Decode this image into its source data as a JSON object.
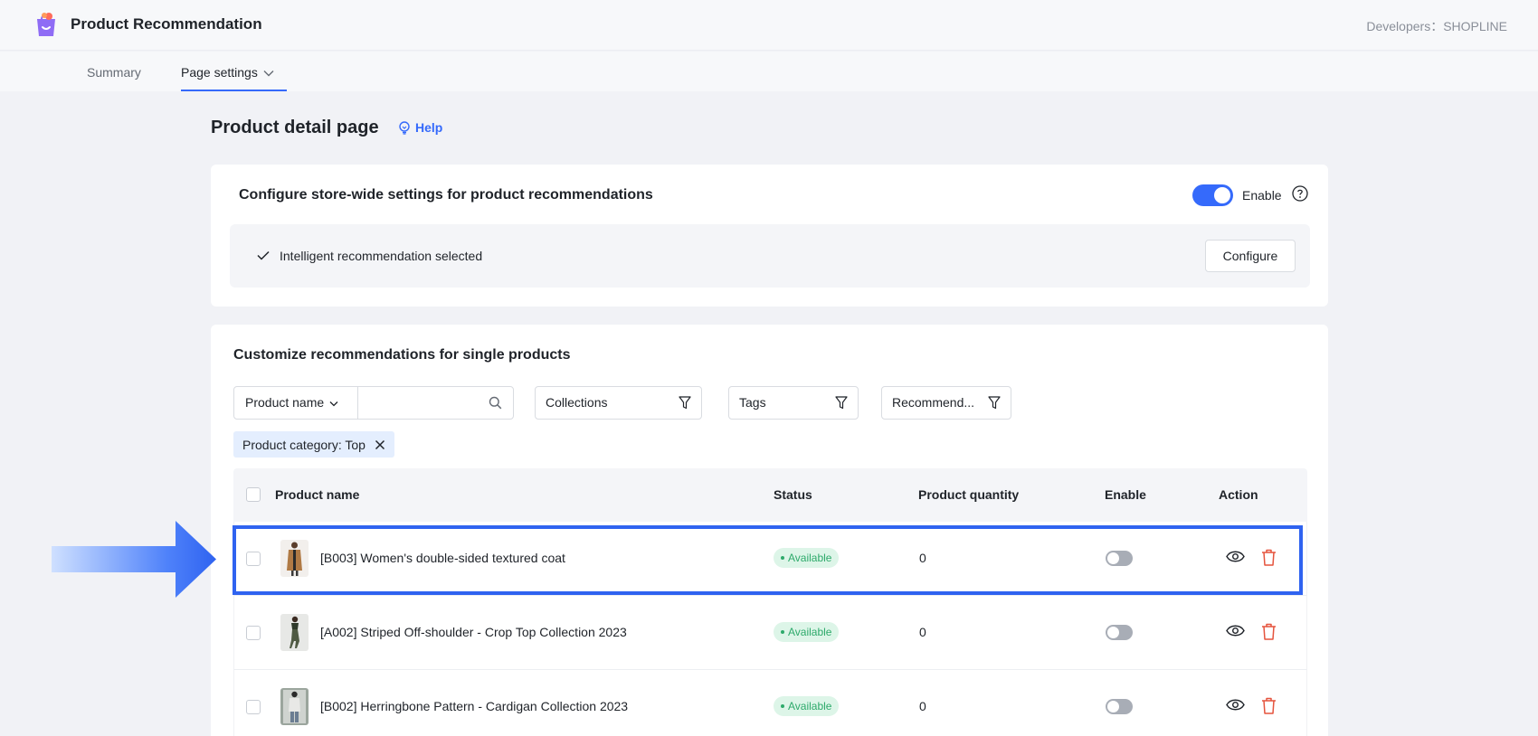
{
  "header": {
    "app_title": "Product Recommendation",
    "developer": "Developers：SHOPLINE"
  },
  "tabs": [
    {
      "label": "Summary"
    },
    {
      "label": "Page settings"
    }
  ],
  "page": {
    "title": "Product detail page",
    "help": "Help"
  },
  "store_settings": {
    "title": "Configure store-wide settings for product recommendations",
    "enable_label": "Enable",
    "status_text": "Intelligent recommendation selected",
    "configure_label": "Configure"
  },
  "single_products": {
    "title": "Customize recommendations for single products",
    "filters": {
      "name_select": "Product name",
      "search_placeholder": "",
      "collections": "Collections",
      "tags": "Tags",
      "recommend": "Recommend..."
    },
    "chip": "Product category: Top",
    "columns": {
      "name": "Product name",
      "status": "Status",
      "quantity": "Product quantity",
      "enable": "Enable",
      "action": "Action"
    },
    "rows": [
      {
        "name": "[B003] Women's double-sided textured coat",
        "status": "Available",
        "quantity": "0",
        "enabled": false
      },
      {
        "name": "[A002] Striped Off-shoulder - Crop Top Collection 2023",
        "status": "Available",
        "quantity": "0",
        "enabled": false
      },
      {
        "name": "[B002] Herringbone Pattern - Cardigan Collection 2023",
        "status": "Available",
        "quantity": "0",
        "enabled": false
      }
    ]
  },
  "colors": {
    "accent": "#356afb",
    "highlight": "#2f63f0",
    "available_bg": "#ddf5e8",
    "available_text": "#2eaa6b",
    "delete": "#e5533d"
  }
}
